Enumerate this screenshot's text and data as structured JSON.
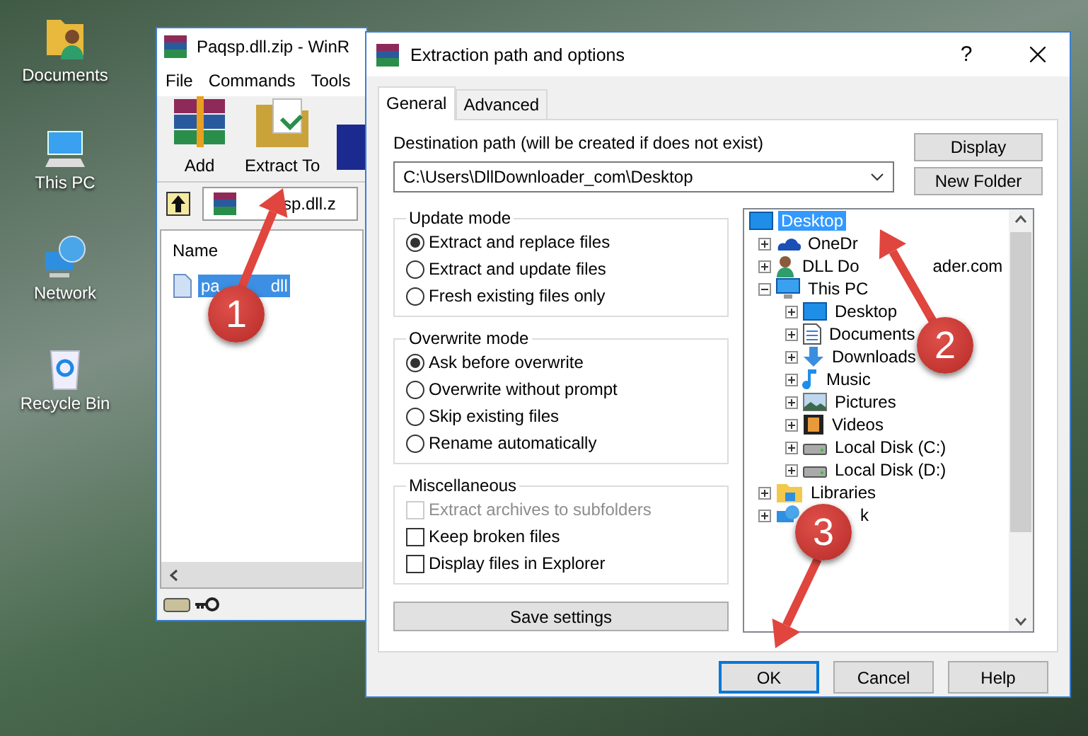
{
  "desktop": {
    "icons": [
      {
        "label": "Documents",
        "kind": "documents"
      },
      {
        "label": "This PC",
        "kind": "pc"
      },
      {
        "label": "Network",
        "kind": "network"
      },
      {
        "label": "Recycle Bin",
        "kind": "bin"
      }
    ]
  },
  "archive_window": {
    "title": "Paqsp.dll.zip - WinR",
    "menu": [
      "File",
      "Commands",
      "Tools"
    ],
    "toolbar": [
      {
        "label": "Add",
        "kind": "add"
      },
      {
        "label": "Extract To",
        "kind": "extract"
      },
      {
        "kind": "test"
      }
    ],
    "path": "sp.dll.z",
    "columns": [
      "Name"
    ],
    "files": [
      {
        "name": "pa",
        "name_after": "dll",
        "selected": true
      }
    ]
  },
  "dialog": {
    "title": "Extraction path and options",
    "title_buttons": [
      "?"
    ],
    "tabs": [
      {
        "label": "General",
        "selected": true
      },
      {
        "label": "Advanced",
        "selected": false
      }
    ],
    "destination_label": "Destination path (will be created if does not exist)",
    "destination_path": "C:\\Users\\DllDownloader_com\\Desktop",
    "side_buttons": [
      "Display",
      "New Folder"
    ],
    "groups": [
      {
        "title": "Update mode",
        "kind": "radio",
        "options": [
          {
            "label": "Extract and replace files",
            "selected": true
          },
          {
            "label": "Extract and update files",
            "selected": false
          },
          {
            "label": "Fresh existing files only",
            "selected": false
          }
        ]
      },
      {
        "title": "Overwrite mode",
        "kind": "radio",
        "options": [
          {
            "label": "Ask before overwrite",
            "selected": true
          },
          {
            "label": "Overwrite without prompt",
            "selected": false
          },
          {
            "label": "Skip existing files",
            "selected": false
          },
          {
            "label": "Rename automatically",
            "selected": false
          }
        ]
      },
      {
        "title": "Miscellaneous",
        "kind": "check",
        "options": [
          {
            "label": "Extract archives to subfolders",
            "checked": false,
            "disabled": true
          },
          {
            "label": "Keep broken files",
            "checked": false,
            "disabled": false
          },
          {
            "label": "Display files in Explorer",
            "checked": false,
            "disabled": false
          }
        ]
      }
    ],
    "save_button": "Save settings",
    "tree": [
      {
        "label": "Desktop",
        "kind": "desktop",
        "selected": true,
        "children": [
          {
            "label": "OneDr",
            "kind": "cloud",
            "selected": false,
            "expanded": false
          },
          {
            "label": "DLL Do",
            "label_after": "ader.com",
            "kind": "user",
            "selected": false,
            "expanded": false
          },
          {
            "label": "This PC",
            "kind": "pc",
            "selected": false,
            "expanded": true,
            "children": [
              {
                "label": "Desktop",
                "kind": "desktop",
                "selected": false,
                "expanded": false
              },
              {
                "label": "Documents",
                "kind": "docs",
                "selected": false,
                "expanded": false
              },
              {
                "label": "Downloads",
                "kind": "download",
                "selected": false,
                "expanded": false
              },
              {
                "label": "Music",
                "kind": "music",
                "selected": false,
                "expanded": false
              },
              {
                "label": "Pictures",
                "kind": "pictures",
                "selected": false,
                "expanded": false
              },
              {
                "label": "Videos",
                "kind": "videos",
                "selected": false,
                "expanded": false
              },
              {
                "label": "Local Disk (C:)",
                "kind": "disk",
                "selected": false,
                "expanded": false
              },
              {
                "label": "Local Disk (D:)",
                "kind": "disk",
                "selected": false,
                "expanded": false
              }
            ]
          },
          {
            "label": "Libraries",
            "kind": "libraries",
            "selected": false,
            "expanded": false
          },
          {
            "label": "k",
            "kind": "netpc",
            "selected": false,
            "expanded": false
          }
        ]
      }
    ],
    "buttons": [
      {
        "label": "OK",
        "default": true
      },
      {
        "label": "Cancel",
        "default": false
      },
      {
        "label": "Help",
        "default": false
      }
    ]
  },
  "annotations": [
    {
      "number": "1"
    },
    {
      "number": "2"
    },
    {
      "number": "3"
    }
  ]
}
